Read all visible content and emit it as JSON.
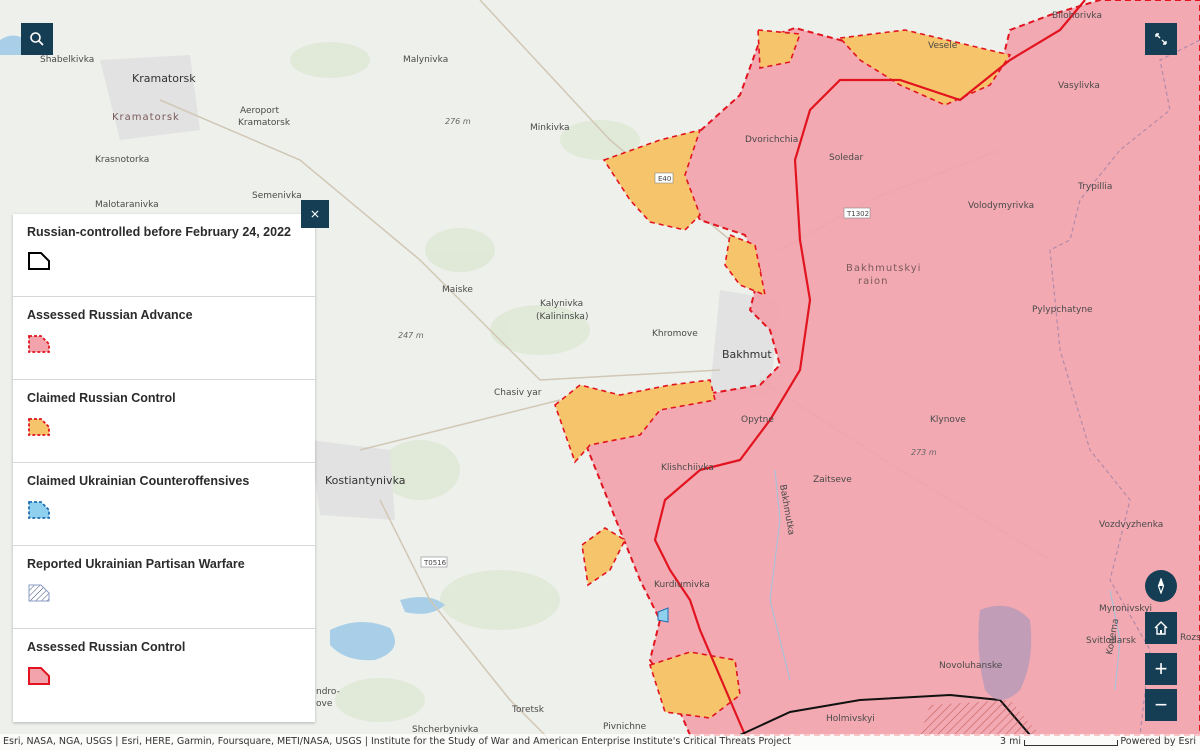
{
  "map": {
    "places": {
      "kramatorsk": "Kramatorsk",
      "kramatorsk_2": "Kramatorsk",
      "shabelkivka": "Shabelkivka",
      "aeroport": "Aeroport",
      "aeroport_2": "Kramatorsk",
      "krasnotorka": "Krasnotorka",
      "malotaranivka": "Malotaranivka",
      "semenivka": "Semenivka",
      "malynivka": "Malynivka",
      "minkivka": "Minkivka",
      "maiske": "Maiske",
      "kalynivka": "Kalynivka",
      "kalynivka_2": "(Kalininska)",
      "khromove": "Khromove",
      "bakhmut": "Bakhmut",
      "chasiv_yar": "Chasiv yar",
      "kostiantynivka": "Kostiantynivka",
      "dvorichchia": "Dvorichchia",
      "soledar": "Soledar",
      "veselе": "Vesele",
      "bilohorivka": "Bilohorivka",
      "vasylivka": "Vasylivka",
      "trypillia": "Trypillia",
      "volodymyrivka": "Volodymyrivka",
      "raion_1": "Bakhmutskyi",
      "raion_2": "raion",
      "pylypchatyne": "Pylypchatyne",
      "opytne": "Opytne",
      "klynove": "Klynove",
      "zaitseve": "Zaitseve",
      "klishchiivka": "Klishchiivka",
      "kurdiumivka": "Kurdiumivka",
      "vozdvyzhenka": "Vozdvyzhenka",
      "myronivskyi": "Myronivskyi",
      "svitlodarsk": "Svitlodarsk",
      "rozsypne": "Rozs",
      "novoluhanske": "Novoluhanske",
      "holmivskyi": "Holmivskyi",
      "pivnichne": "Pivnichne",
      "toretsk": "Toretsk",
      "shcherbynivka": "Shcherbynivka",
      "oleksandro": "ndro-",
      "oleksandro_2": "ove",
      "bakhmutka": "Bakhmutka",
      "kodema": "Kodema"
    },
    "elevations": [
      "276 m",
      "247 m",
      "273 m"
    ],
    "roads": [
      "E40",
      "T1302",
      "T0516"
    ]
  },
  "legend": {
    "close_icon": "close-icon",
    "items": [
      {
        "label": "Russian-controlled before February 24, 2022",
        "swatch": "outline-black"
      },
      {
        "label": "Assessed Russian Advance",
        "swatch": "pink-red-dashed"
      },
      {
        "label": "Claimed Russian Control",
        "swatch": "orange-red-dashed"
      },
      {
        "label": "Claimed Ukrainian Counteroffensives",
        "swatch": "blue-dashed"
      },
      {
        "label": "Reported Ukrainian Partisan Warfare",
        "swatch": "hatched"
      },
      {
        "label": "Assessed Russian Control",
        "swatch": "pink-red-solid"
      }
    ]
  },
  "controls": {
    "search_icon": "search-icon",
    "fullscreen_icon": "fullscreen-icon",
    "compass_icon": "compass-icon",
    "home_icon": "home-icon",
    "zoom_in": "+",
    "zoom_out": "−"
  },
  "attribution": {
    "text": "Esri, NASA, NGA, USGS | Esri, HERE, Garmin, Foursquare, METI/NASA, USGS | Institute for the Study of War and American Enterprise Institute's Critical Threats Project",
    "scale": "3 mi",
    "powered": "Powered by Esri"
  },
  "colors": {
    "russian_control": "#f2a3ac",
    "border_red": "#e2141f",
    "claimed": "#f6c46a",
    "basemap": "#eef0ec"
  }
}
